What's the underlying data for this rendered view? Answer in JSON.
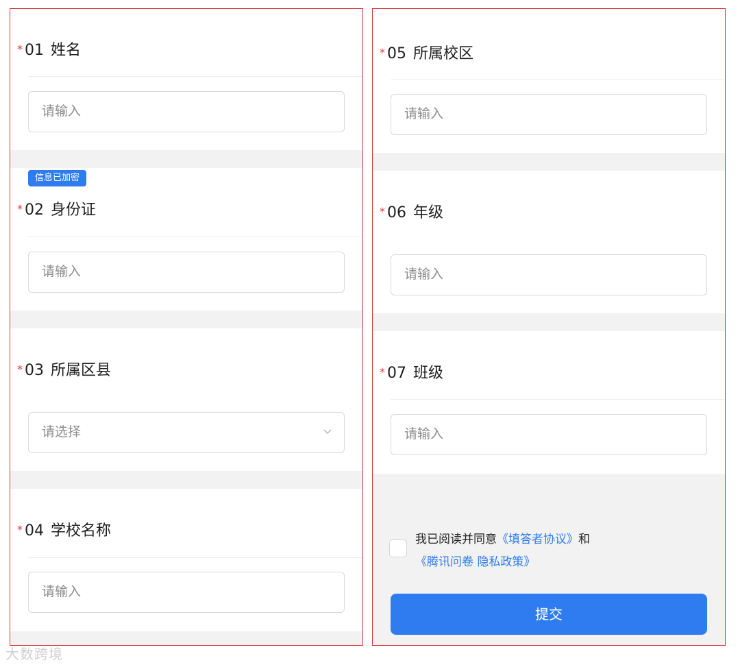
{
  "questions": [
    {
      "required_mark": "*",
      "number": "01",
      "label": "姓名",
      "field_type": "input",
      "placeholder": "请输入"
    },
    {
      "required_mark": "*",
      "number": "02",
      "label": "身份证",
      "field_type": "input",
      "placeholder": "请输入",
      "badge": "信息已加密"
    },
    {
      "required_mark": "*",
      "number": "03",
      "label": "所属区县",
      "field_type": "select",
      "placeholder": "请选择",
      "icon": "chevron-down-icon"
    },
    {
      "required_mark": "*",
      "number": "04",
      "label": "学校名称",
      "field_type": "input",
      "placeholder": "请输入"
    },
    {
      "required_mark": "*",
      "number": "05",
      "label": "所属校区",
      "field_type": "input",
      "placeholder": "请输入"
    },
    {
      "required_mark": "*",
      "number": "06",
      "label": "年级",
      "field_type": "input",
      "placeholder": "请输入"
    },
    {
      "required_mark": "*",
      "number": "07",
      "label": "班级",
      "field_type": "input",
      "placeholder": "请输入"
    }
  ],
  "agreement": {
    "prefix": "我已阅读并同意",
    "link1": "《填答者协议》",
    "conjunction": "和",
    "link2": "《腾讯问卷 隐私政策》",
    "checked": false
  },
  "submit_label": "提交",
  "watermark": "大数跨境",
  "colors": {
    "accent": "#2f7cf0",
    "required": "#e23b3b",
    "panel_border": "#d8333a",
    "separator": "#f2f2f2"
  }
}
